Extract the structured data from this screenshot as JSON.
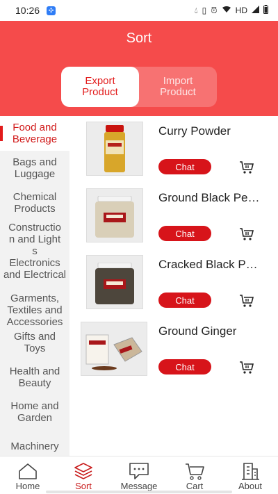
{
  "status_bar": {
    "time": "10:26",
    "network": "HD"
  },
  "header": {
    "title": "Sort"
  },
  "product_type_toggle": {
    "export_label": "Export\nProduct",
    "import_label": "Import\nProduct"
  },
  "sidebar": {
    "items": [
      {
        "label": "Food and Beverage",
        "active": true
      },
      {
        "label": "Bags and Luggage"
      },
      {
        "label": "Chemical Products"
      },
      {
        "label": "Construction and Lights"
      },
      {
        "label": "Electronics and Electrical"
      },
      {
        "label": "Garments, Textiles and Accessories"
      },
      {
        "label": "Gifts and Toys"
      },
      {
        "label": "Health and Beauty"
      },
      {
        "label": "Home and Garden"
      },
      {
        "label": "Machinery"
      }
    ]
  },
  "products": [
    {
      "name": "Curry Powder",
      "chat_label": "Chat"
    },
    {
      "name": "Ground Black Pepper",
      "chat_label": "Chat"
    },
    {
      "name": "Cracked Black Pepper",
      "chat_label": "Chat"
    },
    {
      "name": "Ground Ginger",
      "chat_label": "Chat"
    }
  ],
  "tabbar": {
    "home": "Home",
    "sort": "Sort",
    "message": "Message",
    "cart": "Cart",
    "about": "About"
  },
  "colors": {
    "header": "#f54b4b",
    "accent": "#d7141a"
  }
}
